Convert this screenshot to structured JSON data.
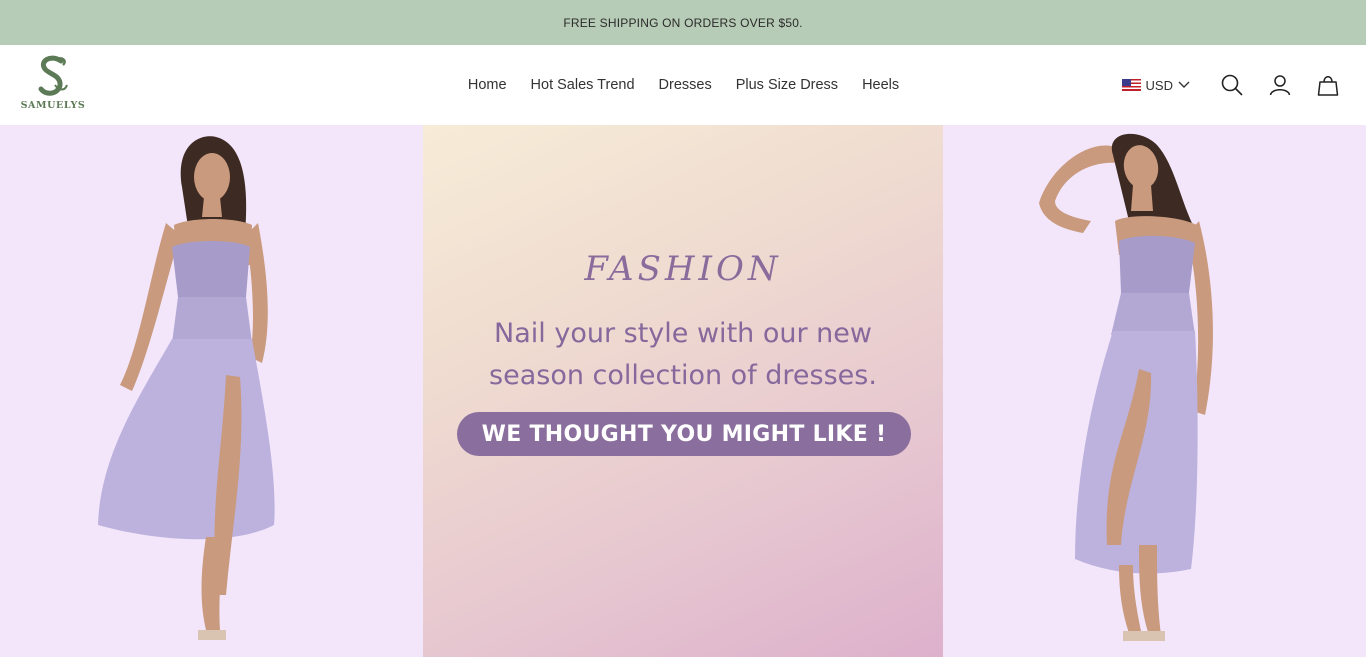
{
  "announcement": "FREE SHIPPING ON ORDERS OVER $50.",
  "brand": {
    "name": "SAMUELYS"
  },
  "nav": [
    {
      "label": "Home"
    },
    {
      "label": "Hot Sales Trend"
    },
    {
      "label": "Dresses"
    },
    {
      "label": "Plus Size Dress"
    },
    {
      "label": "Heels"
    }
  ],
  "tools": {
    "currency": "USD",
    "icons": [
      "flag-us-icon",
      "chevron-down-icon",
      "search-icon",
      "account-icon",
      "cart-icon"
    ]
  },
  "hero": {
    "headline": "FASHION",
    "tagline_line1": "Nail your style with our new",
    "tagline_line2": "season collection of dresses.",
    "cta": "WE THOUGHT YOU MIGHT LIKE !",
    "colors": {
      "side_bg": "#f3e6fb",
      "cta_bg": "#8a6e9d",
      "text_purple": "#87689c",
      "dress_lavender": "#b9afd9"
    }
  },
  "colors": {
    "announcement_bg": "#b7ccb6",
    "brand_green": "#5b7a55"
  }
}
